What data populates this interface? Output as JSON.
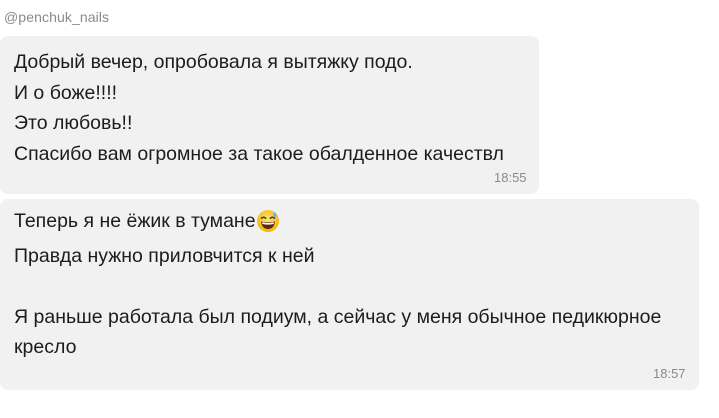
{
  "sender": "@penchuk_nails",
  "messages": [
    {
      "lines": [
        "Добрый вечер, опробовала я вытяжку подо.",
        "И о боже!!!!",
        "Это любовь!!",
        "Спасибо вам огромное за такое обалденное качествл"
      ],
      "time": "18:55"
    },
    {
      "lines": [
        "Теперь я не ёжик в тумане",
        "Правда нужно приловчится к ней",
        "",
        "Я раньше работала был подиум, а сейчас у меня обычное педикюрное",
        "кресло"
      ],
      "emoji": "grinning-sweat-emoji",
      "time": "18:57"
    }
  ],
  "colors": {
    "bubble": "#f1f1f1",
    "text": "#1c1c1c",
    "meta": "#8a8a8a"
  }
}
